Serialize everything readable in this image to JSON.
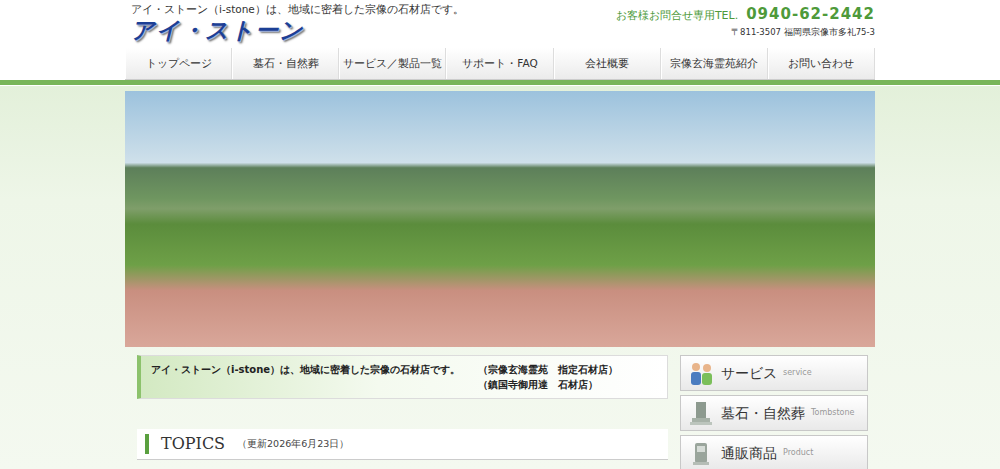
{
  "header": {
    "tagline": "アイ・ストーン（i-stone）は、地域に密着した宗像の石材店です。",
    "logo": "アイ・ストーン",
    "tel_label": "お客様お問合せ専用TEL.",
    "tel": "0940-62-2442",
    "address": "〒811-3507 福岡県宗像市多礼75-3"
  },
  "nav": [
    {
      "label": "トップページ",
      "selected": false
    },
    {
      "label": "墓石・自然葬",
      "selected": false
    },
    {
      "label": "サービス／製品一覧",
      "selected": false
    },
    {
      "label": "サポート・FAQ",
      "selected": false
    },
    {
      "label": "会社概要",
      "selected": false
    },
    {
      "label": "宗像玄海霊苑紹介",
      "selected": false
    },
    {
      "label": "お問い合わせ",
      "selected": false
    }
  ],
  "intro": {
    "text": "アイ・ストーン（i-stone）は、地域に密着した宗像の石材店です。",
    "notes": [
      "（宗像玄海霊苑　指定石材店）",
      "（鎮国寺御用達　石材店）"
    ]
  },
  "topics": {
    "title": "TOPICS",
    "updated": "（更新2026年6月23日）"
  },
  "sidebar": [
    {
      "label": "サービス",
      "sub": "service",
      "kind": "service"
    },
    {
      "label": "墓石・自然葬",
      "sub": "Tombstone",
      "kind": "tombstone"
    },
    {
      "label": "通販商品",
      "sub": "Product",
      "kind": "product"
    }
  ]
}
